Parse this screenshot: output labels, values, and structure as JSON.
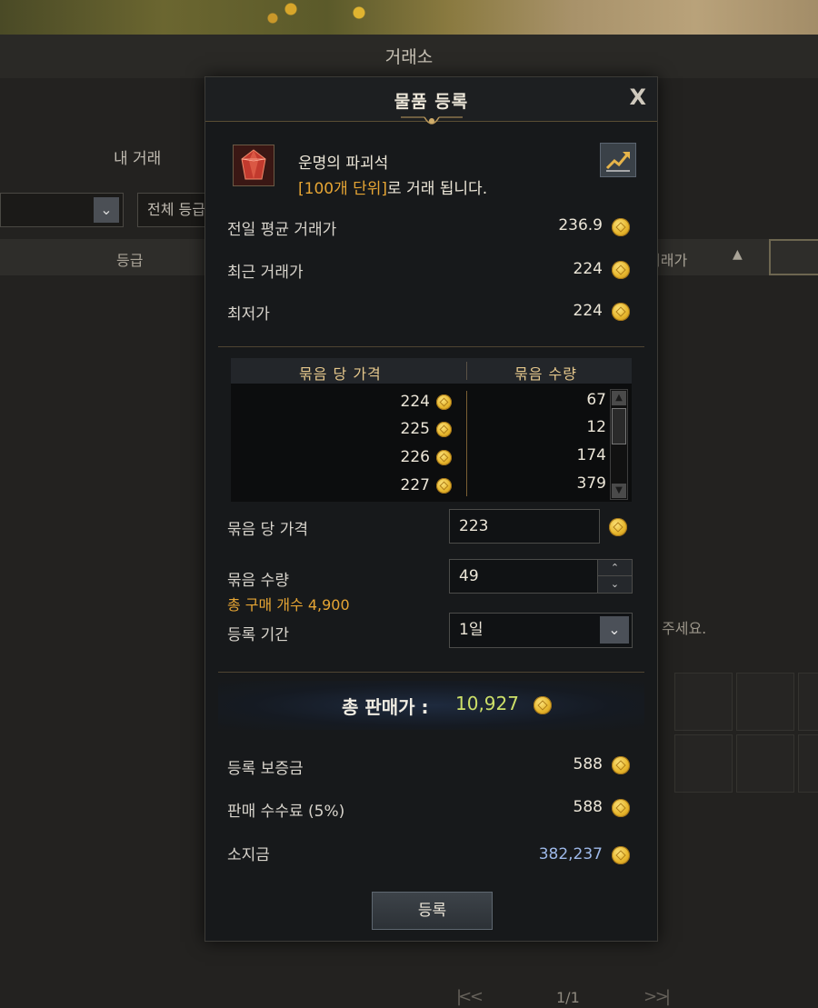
{
  "background": {
    "window_title": "거래소",
    "tab_my_trade": "내 거래",
    "grade_filter": "전체 등급",
    "col_grade": "등급",
    "col_price": "거래가",
    "notice_fragment": "주세요.",
    "pager": "1/1"
  },
  "dialog": {
    "title": "물품 등록",
    "close_label": "X",
    "item": {
      "name": "운명의 파괴석",
      "unit_highlight": "[100개 단위]",
      "unit_suffix": "로 거래 됩니다."
    },
    "stats": [
      {
        "label": "전일 평균 거래가",
        "value": "236.9"
      },
      {
        "label": "최근 거래가",
        "value": "224"
      },
      {
        "label": "최저가",
        "value": "224"
      }
    ],
    "market": {
      "col_price": "묶음 당 가격",
      "col_qty": "묶음 수량",
      "rows": [
        {
          "price": "224",
          "qty": "67"
        },
        {
          "price": "225",
          "qty": "12"
        },
        {
          "price": "226",
          "qty": "174"
        },
        {
          "price": "227",
          "qty": "379"
        }
      ]
    },
    "form": {
      "price_label": "묶음 당 가격",
      "price_value": "223",
      "qty_label": "묶음 수량",
      "qty_value": "49",
      "total_buy_note": "총 구매 개수 4,900",
      "period_label": "등록 기간",
      "period_value": "1일"
    },
    "total": {
      "label": "총 판매가 :",
      "value": "10,927"
    },
    "fees": [
      {
        "label": "등록 보증금",
        "value": "588"
      },
      {
        "label": "판매 수수료 (5%)",
        "value": "588"
      },
      {
        "label": "소지금",
        "value": "382,237"
      }
    ],
    "register_button": "등록"
  },
  "icons": {
    "close": "close-icon",
    "chart": "price-chart-icon",
    "coin": "gold-coin-icon",
    "item": "red-gem-icon",
    "dropdown": "chevron-down-icon"
  },
  "colors": {
    "accent_orange": "#e6a534",
    "total_green": "#cde068",
    "money_blue": "#9db8e8",
    "coin_gold": "#e6b52b"
  }
}
